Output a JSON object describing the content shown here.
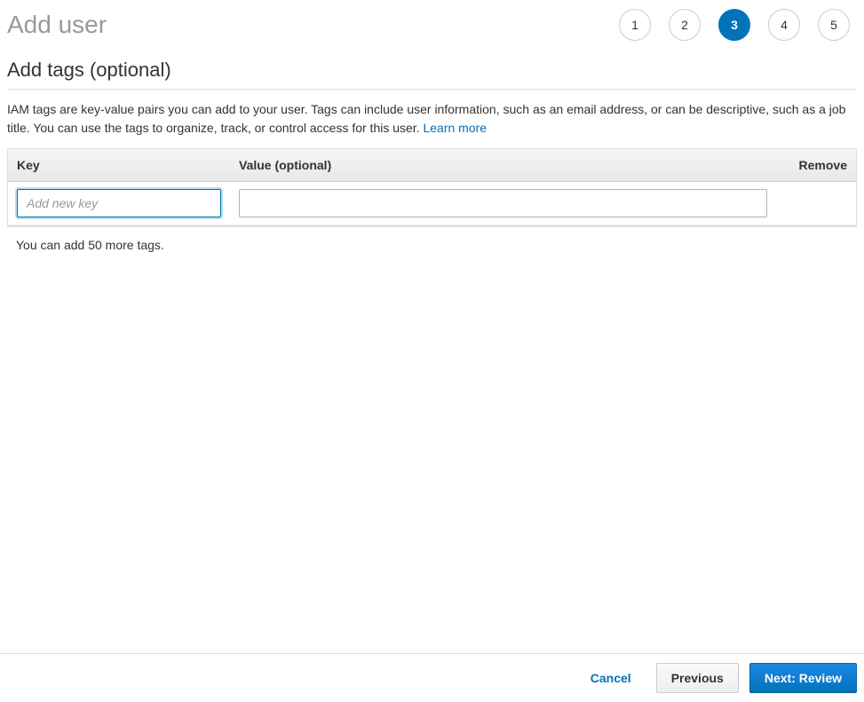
{
  "header": {
    "title": "Add user",
    "steps": [
      "1",
      "2",
      "3",
      "4",
      "5"
    ],
    "active_step_index": 2
  },
  "section": {
    "title": "Add tags (optional)",
    "description": "IAM tags are key-value pairs you can add to your user. Tags can include user information, such as an email address, or can be descriptive, such as a job title. You can use the tags to organize, track, or control access for this user. ",
    "learn_more": "Learn more"
  },
  "table": {
    "columns": {
      "key": "Key",
      "value": "Value (optional)",
      "remove": "Remove"
    },
    "key_placeholder": "Add new key",
    "key_value": "",
    "value_value": ""
  },
  "tag_limit_msg": "You can add 50 more tags.",
  "buttons": {
    "cancel": "Cancel",
    "previous": "Previous",
    "next": "Next: Review"
  }
}
